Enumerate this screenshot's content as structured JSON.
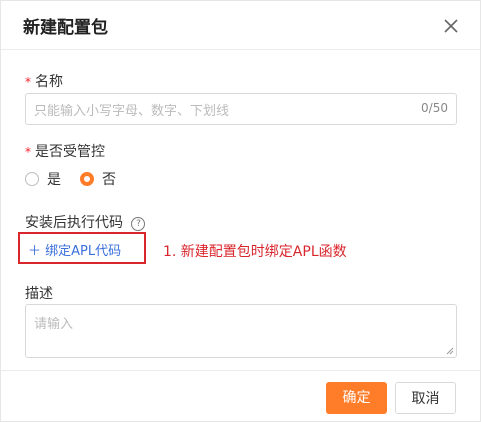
{
  "dialog": {
    "title": "新建配置包",
    "close_icon": "close-icon"
  },
  "name_field": {
    "required_mark": "*",
    "label": "名称",
    "placeholder": "只能输入小写字母、数字、下划线",
    "value": "",
    "counter": "0/50"
  },
  "managed_field": {
    "required_mark": "*",
    "label": "是否受管控",
    "options": [
      {
        "label": "是",
        "checked": false
      },
      {
        "label": "否",
        "checked": true
      }
    ]
  },
  "post_install": {
    "label": "安装后执行代码",
    "help_icon": "question-circle-icon",
    "help_glyph": "?",
    "bind_link": "＋ 绑定APL代码",
    "annotation": "1. 新建配置包时绑定APL函数",
    "highlight_color": "#d9262c"
  },
  "description_field": {
    "label": "描述",
    "placeholder": "请输入",
    "value": ""
  },
  "footer": {
    "ok_label": "确定",
    "cancel_label": "取消"
  },
  "colors": {
    "accent": "#ff7d28",
    "link": "#3a6fdc",
    "required": "#f5222d"
  }
}
